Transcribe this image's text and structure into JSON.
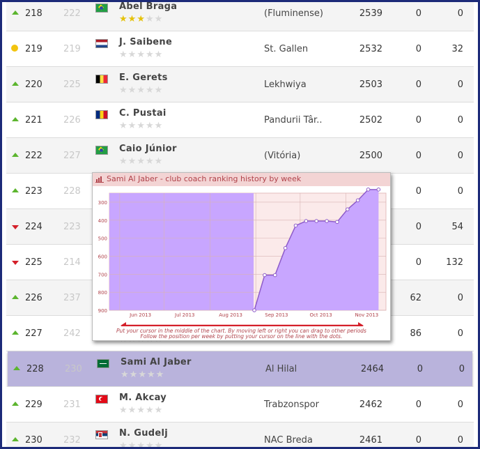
{
  "rows": [
    {
      "trend": "up",
      "rank": "218",
      "prev": "222",
      "flag": "br",
      "name": "Abel Braga",
      "stars": 3,
      "club": "(Fluminense)",
      "points": "2539",
      "c1": "0",
      "c2": "0"
    },
    {
      "trend": "same",
      "rank": "219",
      "prev": "219",
      "flag": "nl",
      "name": "J. Saibene",
      "stars": 0,
      "club": "St. Gallen",
      "points": "2532",
      "c1": "0",
      "c2": "32"
    },
    {
      "trend": "up",
      "rank": "220",
      "prev": "225",
      "flag": "be",
      "name": "E. Gerets",
      "stars": 0,
      "club": "Lekhwiya",
      "points": "2503",
      "c1": "0",
      "c2": "0"
    },
    {
      "trend": "up",
      "rank": "221",
      "prev": "226",
      "flag": "ro",
      "name": "C. Pustai",
      "stars": 0,
      "club": "Pandurii Târ..",
      "points": "2502",
      "c1": "0",
      "c2": "0"
    },
    {
      "trend": "up",
      "rank": "222",
      "prev": "227",
      "flag": "br",
      "name": "Caio Júnior",
      "stars": 0,
      "club": "(Vitória)",
      "points": "2500",
      "c1": "0",
      "c2": "0"
    },
    {
      "trend": "up",
      "rank": "223",
      "prev": "228",
      "flag": "",
      "name": "",
      "stars": null,
      "club": "",
      "points": "",
      "c1": "0",
      "c2": "0"
    },
    {
      "trend": "down",
      "rank": "224",
      "prev": "223",
      "flag": "",
      "name": "",
      "stars": null,
      "club": "",
      "points": "",
      "c1": "0",
      "c2": "54"
    },
    {
      "trend": "down",
      "rank": "225",
      "prev": "214",
      "flag": "",
      "name": "",
      "stars": null,
      "club": "",
      "points": "",
      "c1": "0",
      "c2": "132"
    },
    {
      "trend": "up",
      "rank": "226",
      "prev": "237",
      "flag": "",
      "name": "",
      "stars": null,
      "club": "",
      "points": "",
      "c1": "62",
      "c2": "0"
    },
    {
      "trend": "up",
      "rank": "227",
      "prev": "242",
      "flag": "",
      "name": "",
      "stars": 0,
      "club": "",
      "points": "",
      "c1": "86",
      "c2": "0"
    },
    {
      "trend": "up",
      "rank": "228",
      "prev": "230",
      "flag": "sa",
      "name": "Sami Al Jaber",
      "stars": 0,
      "club": "Al Hilal",
      "points": "2464",
      "c1": "0",
      "c2": "0",
      "highlight": true
    },
    {
      "trend": "up",
      "rank": "229",
      "prev": "231",
      "flag": "tr",
      "name": "M. Akcay",
      "stars": 0,
      "club": "Trabzonspor",
      "points": "2462",
      "c1": "0",
      "c2": "0"
    },
    {
      "trend": "up",
      "rank": "230",
      "prev": "232",
      "flag": "rs",
      "name": "N. Gudelj",
      "stars": 0,
      "club": "NAC Breda",
      "points": "2461",
      "c1": "0",
      "c2": "0"
    }
  ],
  "popup": {
    "title": "Sami Al Jaber - club coach ranking history by week",
    "hint_line1": "Put your cursor in the middle of the chart. By moving left or right you can drag to other periods",
    "hint_line2": "Follow the position per week by putting your cursor on the line with the dots."
  },
  "colors": {
    "frame": "#1c2a78",
    "highlight_row": "#b9b3dc",
    "area_fill": "#c8a6ff",
    "line": "#8d5bc9",
    "trend_up": "#5cb52e",
    "trend_down": "#d4202a",
    "star_on": "#e5c20a"
  },
  "chart_data": {
    "type": "line",
    "title": "Sami Al Jaber - club coach ranking history by week",
    "x_tick_labels": [
      "Jun 2013",
      "Jul 2013",
      "Aug 2013",
      "Sep 2013",
      "Oct 2013",
      "Nov 2013"
    ],
    "y_tick_labels": [
      "300",
      "400",
      "500",
      "600",
      "700",
      "800",
      "900"
    ],
    "ylim": [
      900,
      250
    ],
    "y_inverted": true,
    "x": [
      "Aug 31 2013",
      "Sep 7 2013",
      "Sep 14 2013",
      "Sep 21 2013",
      "Sep 28 2013",
      "Oct 5 2013",
      "Oct 12 2013",
      "Oct 19 2013",
      "Oct 26 2013",
      "Nov 2 2013",
      "Nov 9 2013",
      "Nov 16 2013",
      "Nov 23 2013"
    ],
    "series": [
      {
        "values": [
          900,
          705,
          705,
          555,
          430,
          405,
          405,
          405,
          410,
          340,
          290,
          230,
          230
        ]
      }
    ],
    "no_data_region": [
      "May 2013",
      "Aug 31 2013"
    ]
  }
}
